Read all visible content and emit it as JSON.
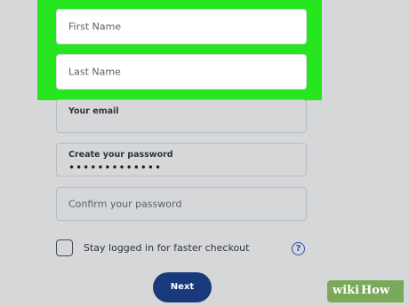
{
  "form": {
    "first_name_placeholder": "First Name",
    "last_name_placeholder": "Last Name",
    "email_label": "Your email",
    "password_label": "Create your password",
    "password_value": "•••••••••••••",
    "confirm_password_placeholder": "Confirm your password",
    "stay_logged_in_label": "Stay logged in for faster checkout",
    "stay_logged_in_checked": false,
    "help_icon_glyph": "?",
    "next_button_label": "Next"
  },
  "watermark": {
    "wiki": "wiki",
    "how": "How"
  },
  "colors": {
    "highlight": "#26e71f",
    "primary_button": "#183a7c",
    "help_icon": "#2f4fa8",
    "background": "#d6d7d9"
  }
}
